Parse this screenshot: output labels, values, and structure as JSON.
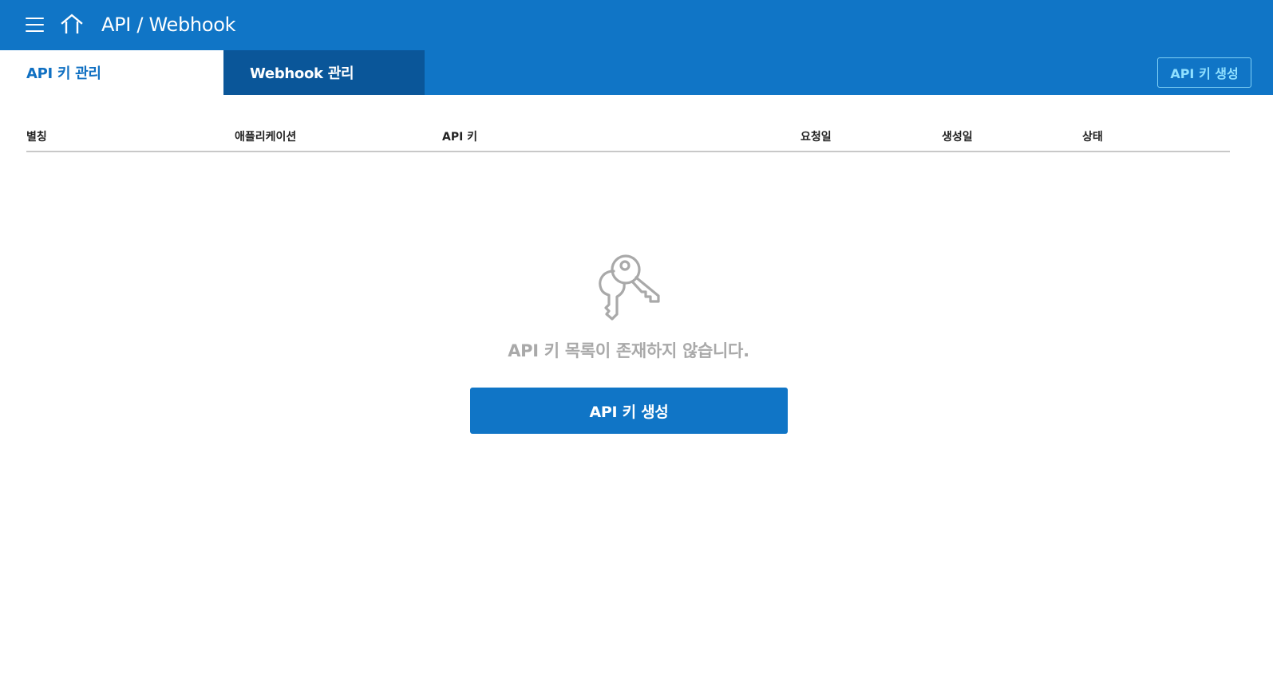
{
  "header": {
    "title": "API / Webhook",
    "menu_icon": "hamburger-menu-icon",
    "home_icon": "home-icon"
  },
  "tabs": [
    {
      "label": "API 키 관리",
      "active": true
    },
    {
      "label": "Webhook 관리",
      "active": false
    }
  ],
  "actions": {
    "create_key_label": "API 키 생성"
  },
  "table": {
    "columns": [
      "별칭",
      "애플리케이션",
      "API 키",
      "요청일",
      "생성일",
      "상태"
    ],
    "rows": []
  },
  "empty_state": {
    "icon": "key-icon",
    "message": "API 키 목록이 존재하지 않습니다.",
    "button_label": "API 키 생성"
  },
  "colors": {
    "primary": "#1075c6",
    "tab_inactive": "#0a5699",
    "accent_text": "#8fe0ff",
    "muted_text": "#a9a9a9"
  }
}
